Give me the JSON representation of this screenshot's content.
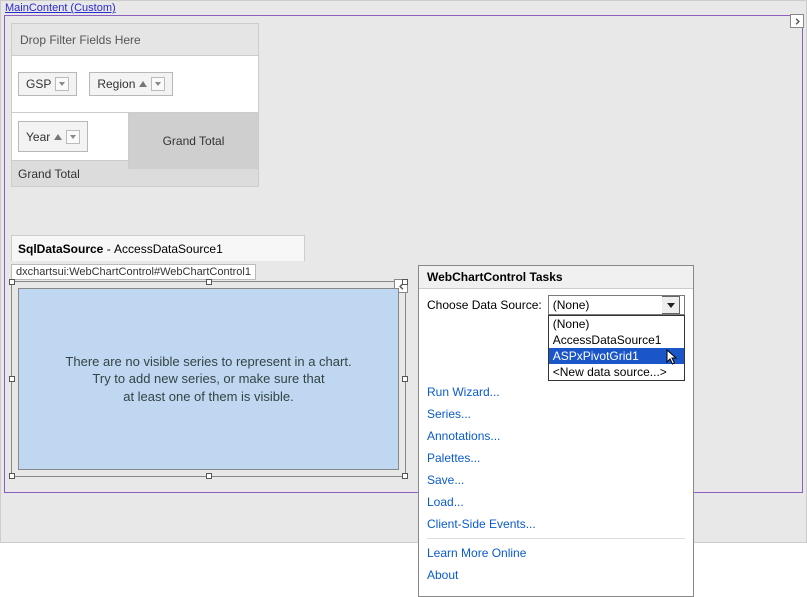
{
  "header": {
    "label": "MainContent (Custom)"
  },
  "pivot": {
    "filter_placeholder": "Drop Filter Fields Here",
    "col_field": "GSP",
    "col_field2": "Region",
    "row_field": "Year",
    "grand_total": "Grand Total"
  },
  "datasource": {
    "type": "SqlDataSource",
    "name": "AccessDataSource1"
  },
  "chart": {
    "tag": "dxchartsui:WebChartControl#WebChartControl1",
    "msg_l1": "There are no visible series to represent in a chart.",
    "msg_l2": "Try to add new series, or make sure that",
    "msg_l3": "at least one of them is visible."
  },
  "tasks": {
    "title": "WebChartControl Tasks",
    "choose_label": "Choose Data Source:",
    "selected": "(None)",
    "options": {
      "none": "(None)",
      "ads": "AccessDataSource1",
      "pg": "ASPxPivotGrid1",
      "new": "<New data source...>"
    },
    "links": {
      "runwiz": "Run Wizard...",
      "series": "Series...",
      "annot": "Annotations...",
      "pal": "Palettes...",
      "save": "Save...",
      "load": "Load...",
      "cse": "Client-Side Events...",
      "learn": "Learn More Online",
      "about": "About"
    }
  }
}
